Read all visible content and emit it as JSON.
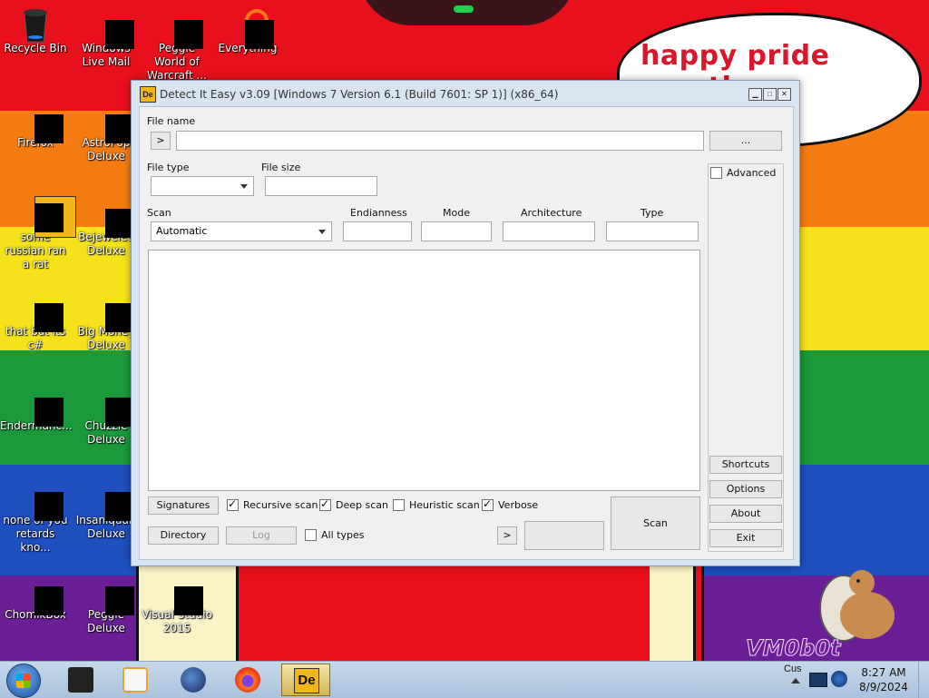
{
  "wallpaper": {
    "speech_bubble": "happy pride month",
    "watermark": "VM0b0t"
  },
  "desktop_icons": [
    {
      "label": "Recycle Bin",
      "icon": "recycle-bin-icon"
    },
    {
      "label": "Windows Live Mail",
      "icon": "mail-icon"
    },
    {
      "label": "Peggle World of Warcraft ...",
      "icon": "game-icon"
    },
    {
      "label": "Everything",
      "icon": "search-app-icon"
    },
    {
      "label": "Firefox",
      "icon": "firefox-icon"
    },
    {
      "label": "AstroPop Deluxe",
      "icon": "game-icon"
    },
    {
      "label": "some russian ran a rat",
      "icon": "die-icon"
    },
    {
      "label": "Bejeweled Deluxe",
      "icon": "gem-icon"
    },
    {
      "label": "that but its c#",
      "icon": "shortcut-icon"
    },
    {
      "label": "Big Money Deluxe",
      "icon": "money-icon"
    },
    {
      "label": "Endermanc...",
      "icon": "app-icon"
    },
    {
      "label": "Chuzzle Deluxe",
      "icon": "game-icon"
    },
    {
      "label": "none of you retards kno...",
      "icon": "app-icon"
    },
    {
      "label": "Insaniquari Deluxe",
      "icon": "fish-icon"
    },
    {
      "label": "ChomikBox",
      "icon": "hamster-icon"
    },
    {
      "label": "Peggle Deluxe",
      "icon": "game-icon"
    },
    {
      "label": "Visual Studio 2015",
      "icon": "visual-studio-icon"
    }
  ],
  "window": {
    "title": "Detect It Easy v3.09 [Windows 7 Version 6.1 (Build 7601: SP 1)] (x86_64)",
    "icon_text": "De",
    "file_name_label": "File name",
    "file_name_value": "",
    "open_arrow": ">",
    "browse_button": "...",
    "file_type_label": "File type",
    "file_type_value": "",
    "file_size_label": "File size",
    "file_size_value": "",
    "scan_label": "Scan",
    "scan_mode": "Automatic",
    "endianness_label": "Endianness",
    "mode_label": "Mode",
    "architecture_label": "Architecture",
    "type_label": "Type",
    "advanced_label": "Advanced",
    "advanced_checked": false,
    "side_buttons": {
      "shortcuts": "Shortcuts",
      "options": "Options",
      "about": "About",
      "exit": "Exit"
    },
    "signatures_button": "Signatures",
    "directory_button": "Directory",
    "log_button": "Log",
    "recursive_scan": {
      "label": "Recursive scan",
      "checked": true
    },
    "deep_scan": {
      "label": "Deep scan",
      "checked": true
    },
    "heuristic_scan": {
      "label": "Heuristic scan",
      "checked": false
    },
    "verbose": {
      "label": "Verbose",
      "checked": true
    },
    "all_types": {
      "label": "All types",
      "checked": false
    },
    "next_arrow": ">",
    "scan_button": "Scan"
  },
  "taskbar": {
    "tray_text": "Cus",
    "time": "8:27 AM",
    "date": "8/9/2024",
    "active_app_icon_text": "De"
  }
}
